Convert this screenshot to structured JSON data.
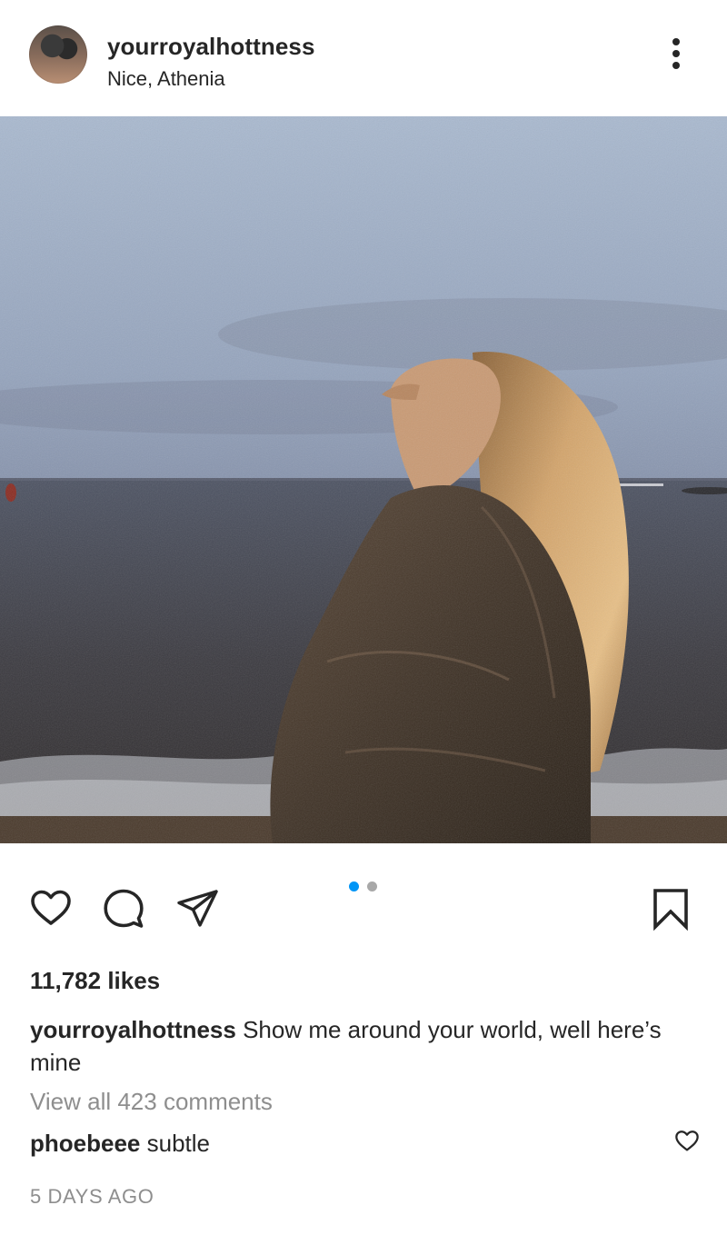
{
  "post": {
    "username": "yourroyalhottness",
    "location": "Nice, Athenia",
    "likes_text": "11,782 likes",
    "caption": {
      "username": "yourroyalhottness",
      "text": "Show me around your world, well here’s mine"
    },
    "view_comments": "View all 423 comments",
    "comment": {
      "username": "phoebeee",
      "text": "subtle"
    },
    "timestamp": "5 DAYS AGO",
    "carousel": {
      "count": 2,
      "active_index": 0
    }
  },
  "icons": {
    "more": "more-vertical-icon",
    "like": "heart-icon",
    "comment": "comment-bubble-icon",
    "share": "paper-plane-icon",
    "save": "bookmark-icon",
    "comment_like": "heart-icon"
  },
  "colors": {
    "text": "#262626",
    "muted": "#8e8e8e",
    "accent_dot": "#0095f6",
    "inactive_dot": "#a8a8a8"
  }
}
